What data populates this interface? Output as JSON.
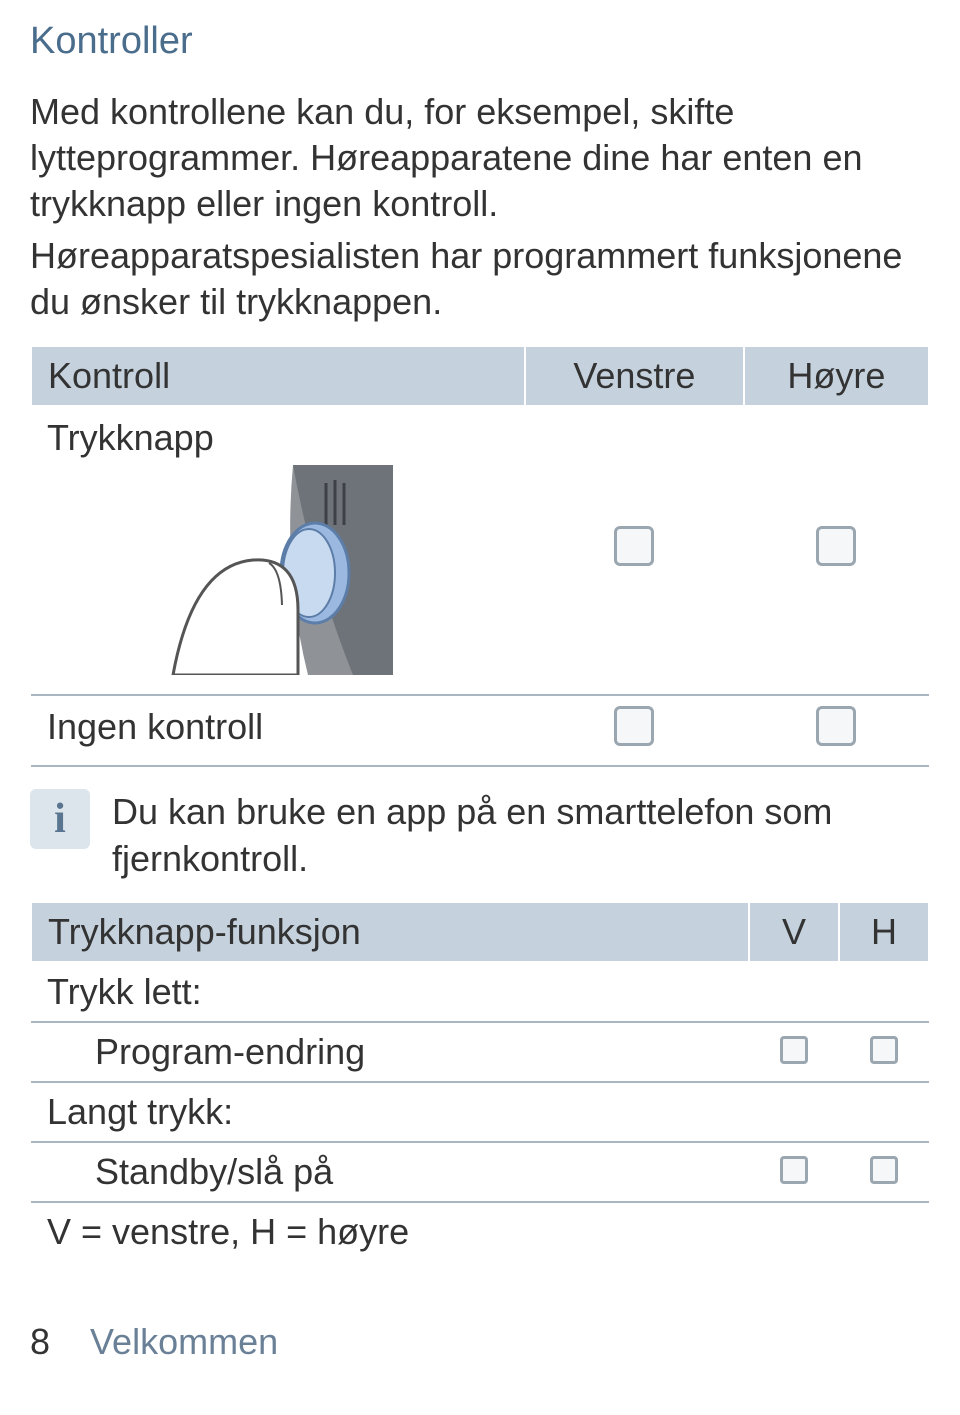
{
  "heading": "Kontroller",
  "intro": {
    "p1": "Med kontrollene kan du, for eksempel, skifte lytteprogrammer. Høreapparatene dine har enten en trykknapp eller ingen kontroll.",
    "p2": "Høreapparatspesialisten har programmert funksjonene du ønsker til trykknappen."
  },
  "control_table": {
    "headers": {
      "main": "Kontroll",
      "left": "Venstre",
      "right": "Høyre"
    },
    "rows": {
      "trykknapp": "Trykknapp",
      "ingen": "Ingen kontroll"
    }
  },
  "info_note": "Du kan bruke en app på en smarttelefon som fjernkontroll.",
  "func_table": {
    "headers": {
      "main": "Trykknapp-funksjon",
      "left": "V",
      "right": "H"
    },
    "rows": {
      "trykk_lett": "Trykk lett:",
      "program_endring": "Program-endring",
      "langt_trykk": "Langt trykk:",
      "standby": "Standby/slå på",
      "legend": "V = venstre, H = høyre"
    }
  },
  "footer": {
    "page": "8",
    "section": "Velkommen"
  }
}
